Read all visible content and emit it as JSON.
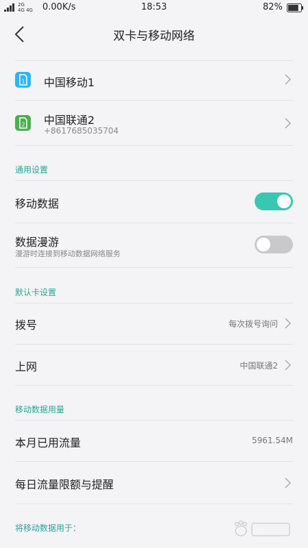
{
  "status_bar": {
    "network_top": "2G",
    "network_bottom": "4G 4G",
    "speed": "0.00K/s",
    "time": "18:53",
    "battery": "82%",
    "battery_level": 0.82
  },
  "header": {
    "title": "双卡与移动网络"
  },
  "sims": [
    {
      "name": "中国移动1",
      "number": "",
      "slot": "1",
      "color": "#29b6f6"
    },
    {
      "name": "中国联通2",
      "number": "+8617685035704",
      "slot": "2",
      "color": "#4caf50"
    }
  ],
  "general": {
    "label": "通用设置",
    "mobile_data": {
      "title": "移动数据",
      "enabled": true
    },
    "roaming": {
      "title": "数据漫游",
      "subtitle": "漫游时连接到移动数据网络服务",
      "enabled": false
    }
  },
  "default_sim": {
    "label": "默认卡设置",
    "dial": {
      "title": "拨号",
      "value": "每次拨号询问"
    },
    "internet": {
      "title": "上网",
      "value": "中国联通2"
    }
  },
  "usage": {
    "label": "移动数据用量",
    "this_month": {
      "title": "本月已用流量",
      "value": "5961.54M"
    },
    "daily_limit": {
      "title": "每日流量限额与提醒"
    }
  },
  "use_data_for": {
    "label": "将移动数据用于："
  },
  "colors": {
    "accent": "#26a69a",
    "toggle_on": "#3ac7b1",
    "toggle_off": "#c9c9cb",
    "background": "#f4f3f5"
  }
}
